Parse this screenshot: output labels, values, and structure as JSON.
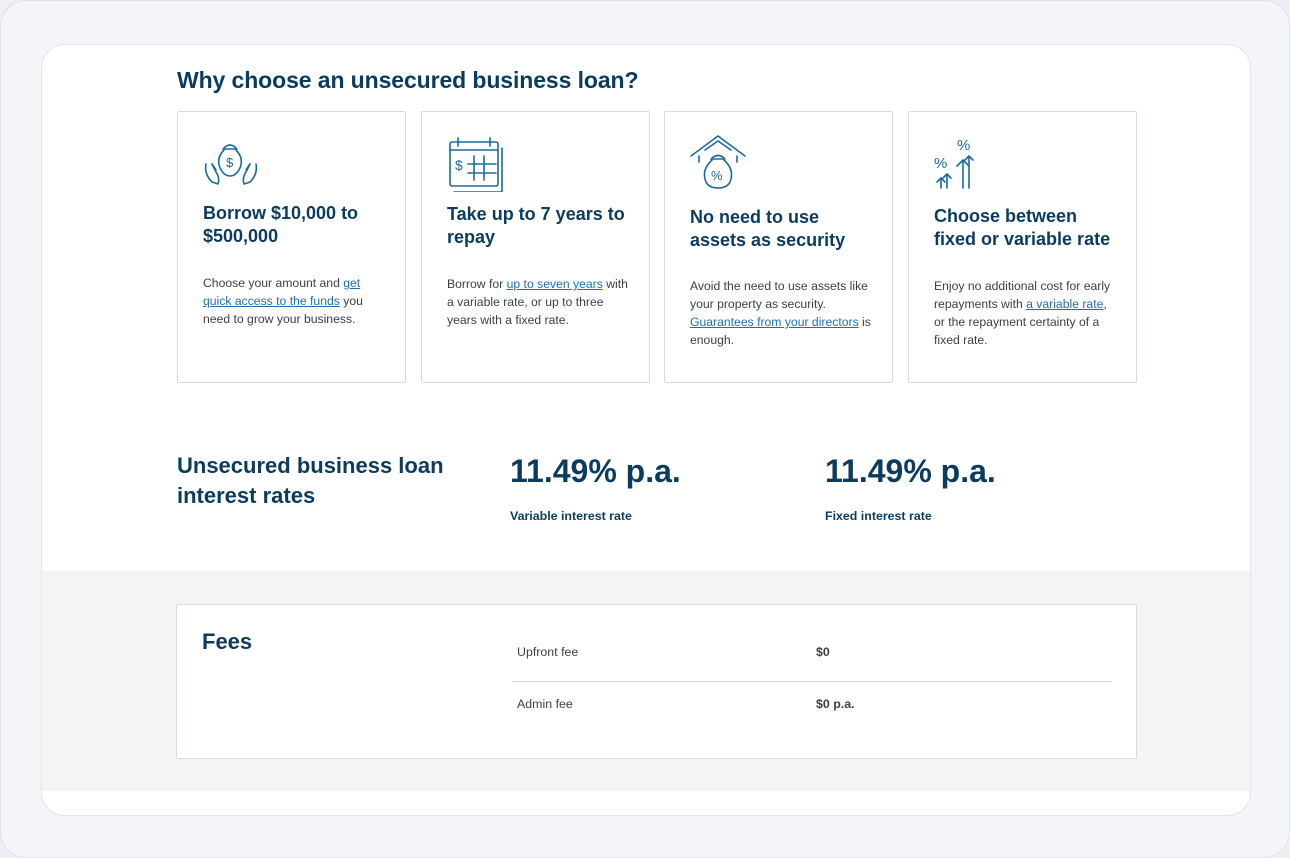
{
  "why": {
    "title": "Why choose an unsecured business loan?",
    "cards": [
      {
        "icon": "money-bag-hands-icon",
        "title": "Borrow $10,000 to $500,000",
        "text_before": "Choose your amount and ",
        "link": "get quick access to the funds",
        "text_after": " you need to grow your business."
      },
      {
        "icon": "calendar-dollar-icon",
        "title": "Take up to 7 years to repay",
        "text_before": "Borrow for ",
        "link": "up to seven years",
        "text_after": " with a variable rate, or up to three years with a fixed rate."
      },
      {
        "icon": "house-money-bag-icon",
        "title": "No need to use assets as security",
        "text_before": "Avoid the need to use assets like your property as security. ",
        "link": "Guarantees from your directors",
        "text_after": " is enough."
      },
      {
        "icon": "percent-arrows-icon",
        "title": "Choose between fixed or variable rate",
        "text_before": "Enjoy no additional cost for early repayments with ",
        "link": "a variable rate",
        "text_after": ", or the repayment certainty of a fixed rate."
      }
    ]
  },
  "rates": {
    "title": "Unsecured business loan interest rates",
    "variable": {
      "value": "11.49% p.a.",
      "label": "Variable interest rate"
    },
    "fixed": {
      "value": "11.49% p.a.",
      "label": "Fixed interest rate"
    }
  },
  "fees": {
    "title": "Fees",
    "rows": [
      {
        "name": "Upfront fee",
        "value": "$0"
      },
      {
        "name": "Admin fee",
        "value": "$0 p.a."
      }
    ]
  },
  "colors": {
    "heading": "#0b3b5f",
    "link": "#1f6fb0",
    "icon_stroke": "#1a6aa0"
  }
}
